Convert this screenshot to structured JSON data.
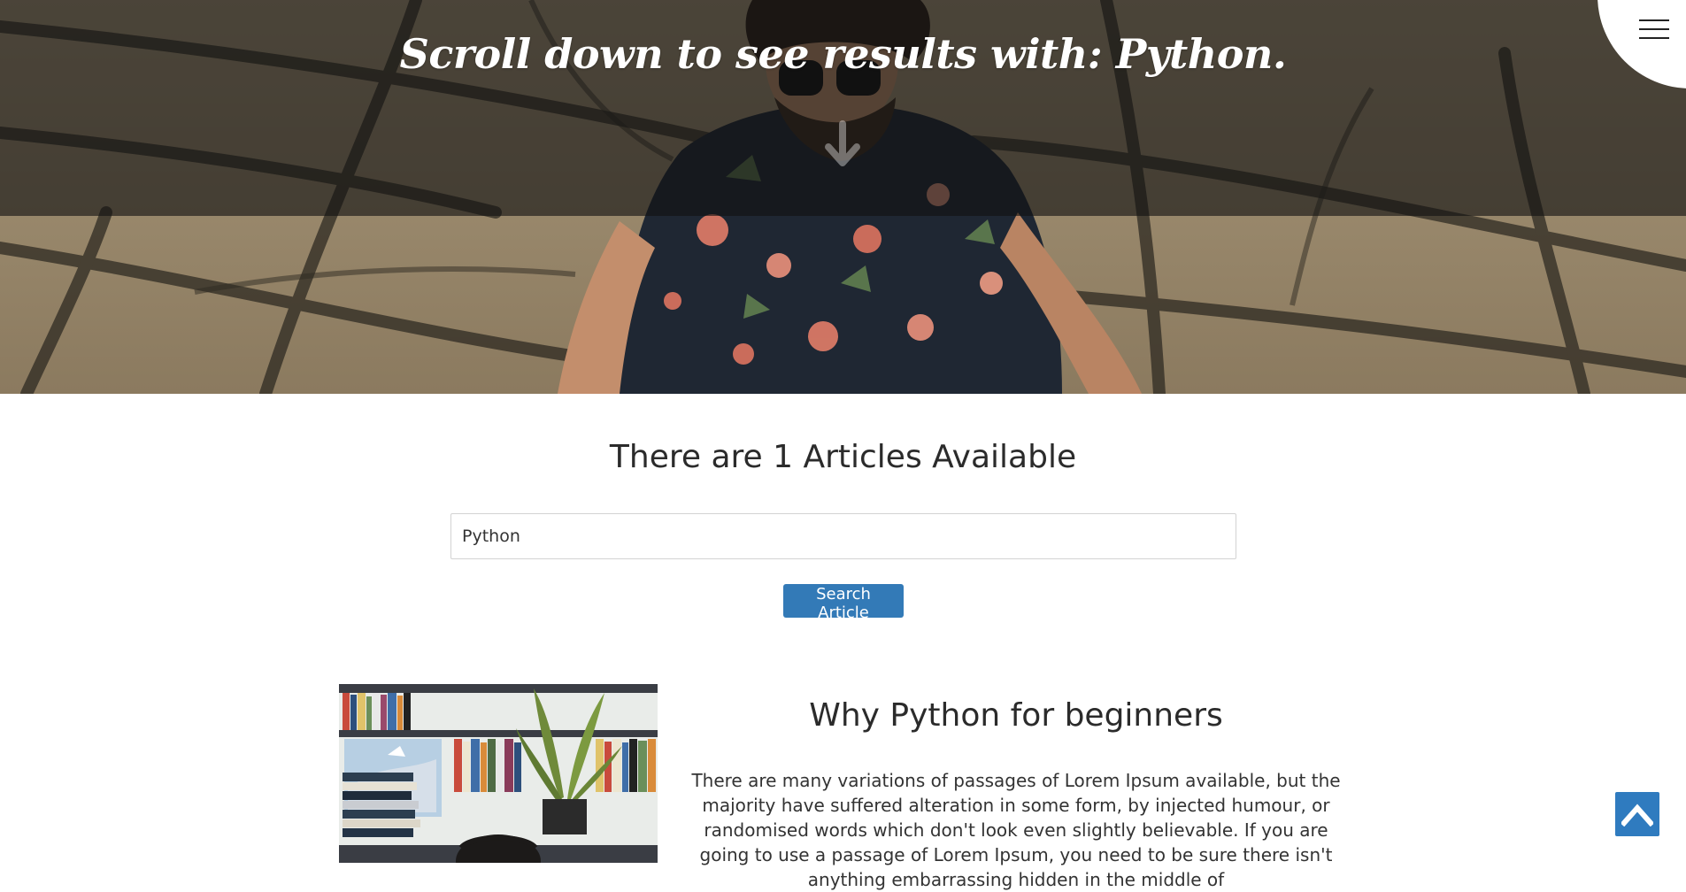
{
  "hero": {
    "title": "Scroll down to see results with: Python.",
    "scroll_icon": "arrow-down-icon",
    "menu_icon": "hamburger-menu-icon"
  },
  "search": {
    "heading": "There are 1 Articles Available",
    "value": "Python",
    "button_label": "Search Article"
  },
  "article": {
    "title": "Why Python for beginners",
    "excerpt": "There are many variations of passages of Lorem Ipsum available, but the majority have suffered alteration in some form, by injected humour, or randomised words which don't look even slightly believable. If you are going to use a passage of Lorem Ipsum, you need to be sure there isn't anything embarrassing hidden in the middle of"
  },
  "back_to_top": {
    "icon": "chevron-up-icon"
  },
  "colors": {
    "accent": "#337ab7",
    "back_to_top": "#2f7bbf",
    "hero_overlay": "#121212"
  }
}
